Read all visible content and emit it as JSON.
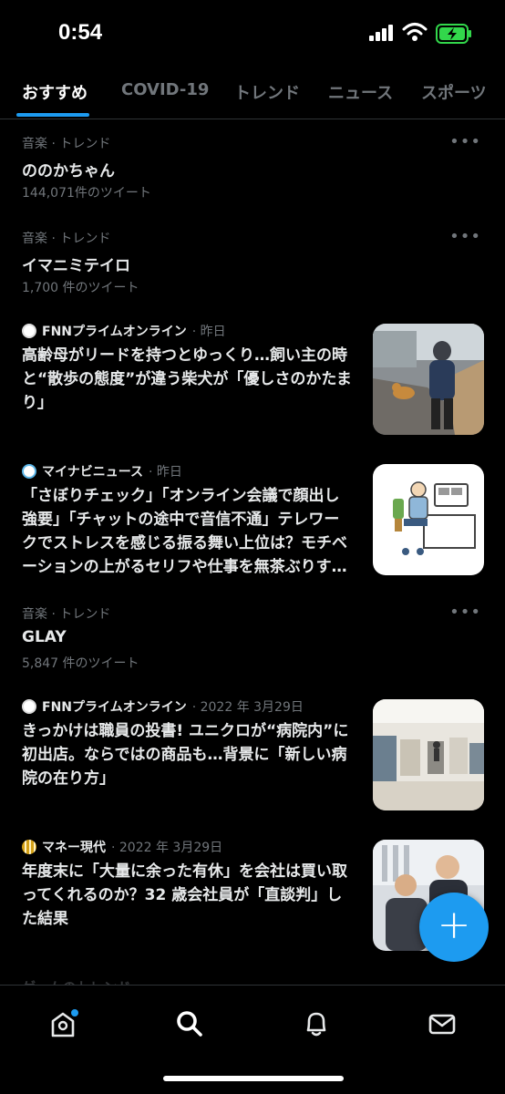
{
  "status_bar": {
    "time": "0:54"
  },
  "tabs": [
    {
      "label": "おすすめ",
      "active": true
    },
    {
      "label": "COVID-19"
    },
    {
      "label": "トレンド"
    },
    {
      "label": "ニュース"
    },
    {
      "label": "スポーツ"
    }
  ],
  "trends": [
    {
      "category": "音楽 · トレンド",
      "title": "ののかちゃん",
      "count": "144,071件のツイート"
    },
    {
      "category": "音楽 · トレンド",
      "title": "イマニミテイロ",
      "count": "1,700 件のツイート"
    },
    {
      "category": "音楽 · トレンド",
      "title": "GLAY",
      "count": "5,847 件のツイート"
    }
  ],
  "news": [
    {
      "source": "FNNプライムオンライン",
      "time": "· 昨日",
      "headline": [
        "高齢母がリードを持つとゆっくり…飼い主の時",
        "と“散歩の態度”が違う柴犬が「優しさのかたま",
        "り」"
      ]
    },
    {
      "source": "マイナビニュース",
      "time": "· 昨日",
      "headline": [
        "「さぼりチェック」「オンライン会議で顔出し",
        "強要」「チャットの途中で音信不通」テレワー",
        "クでストレスを感じる振る舞い上位は？モチベ",
        "ーションの上がるセリフや仕事を無茶ぶりす…"
      ]
    },
    {
      "source": "FNNプライムオンライン",
      "time": "· 2022 年 3月29日",
      "headline": [
        "きっかけは職員の投書! ユニクロが“病院内”に",
        "初出店。ならではの商品も…背景に「新しい病",
        "院の在り方」"
      ]
    },
    {
      "source": "マネー現代",
      "time": "· 2022 年 3月29日",
      "headline": [
        "年度末に「大量に余った有休」を会社は買い取",
        "ってくれるのか？32 歳会社員が「直談判」し",
        "た結果"
      ]
    }
  ],
  "more_label": "•••",
  "fab_label": "+",
  "peek_text": "ゲームのトレンド",
  "nav": [
    "home-icon",
    "search-icon",
    "bell-icon",
    "mail-icon"
  ],
  "colors": {
    "accent": "#1d9bf0",
    "background": "#000000",
    "muted": "#71767b"
  }
}
